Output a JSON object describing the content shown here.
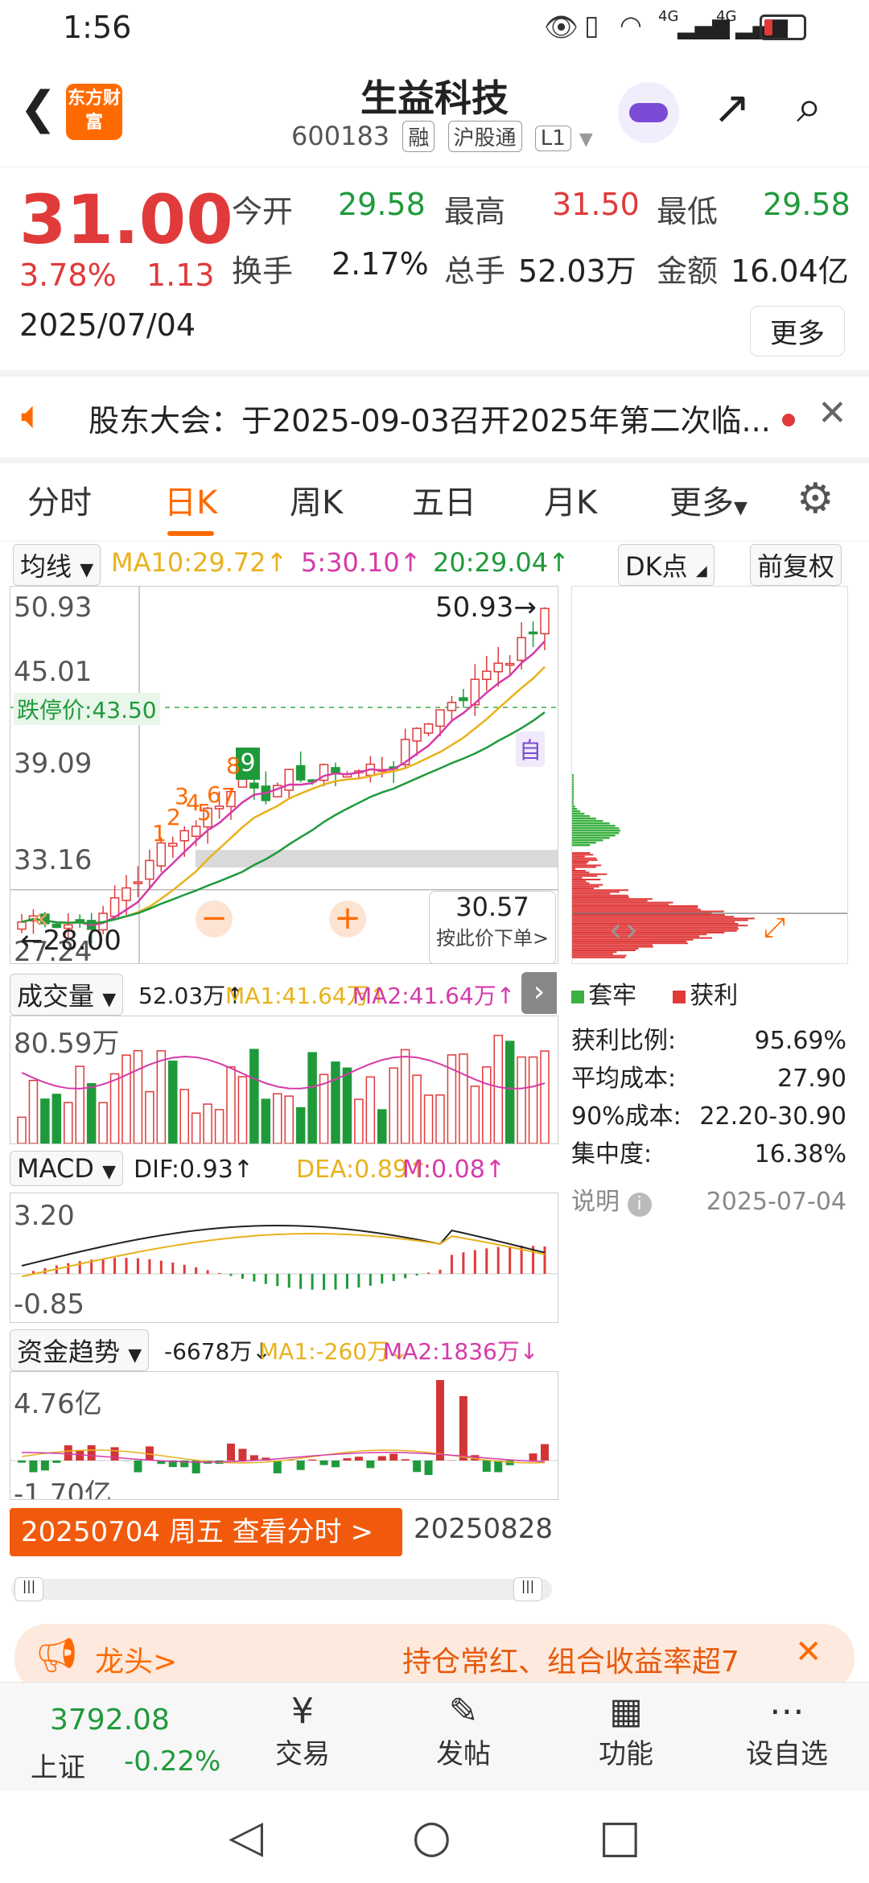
{
  "status_bar": {
    "time": "1:56",
    "net1": "4G",
    "net2": "4G"
  },
  "header": {
    "title": "生益科技",
    "code": "600183",
    "tags": [
      "融",
      "沪股通",
      "L1"
    ],
    "logo_text": "东方财富"
  },
  "quote": {
    "price": "31.00",
    "change_pct": "3.78%",
    "change": "1.13",
    "date": "2025/07/04",
    "open_label": "今开",
    "open": "29.58",
    "high_label": "最高",
    "high": "31.50",
    "low_label": "最低",
    "low": "29.58",
    "turnover_label": "换手",
    "turnover": "2.17%",
    "volume_label": "总手",
    "volume": "52.03万",
    "amount_label": "金额",
    "amount": "16.04亿",
    "more_label": "更多"
  },
  "notice": {
    "text": "股东大会：于2025-09-03召开2025年第二次临..."
  },
  "tabs": {
    "items": [
      "分时",
      "日K",
      "周K",
      "五日",
      "月K",
      "更多"
    ],
    "active": "日K"
  },
  "ma_bar": {
    "selector": "均线",
    "ma10": "MA10:29.72↑",
    "ma5": "5:30.10↑",
    "ma20": "20:29.04↑",
    "dk": "DK点",
    "adjust": "前复权"
  },
  "kline": {
    "price_labels": [
      "50.93",
      "45.01",
      "39.09",
      "33.16",
      "27.24"
    ],
    "limit_down": "跌停价:43.50",
    "max_annotation": "50.93",
    "min_annotation": "28.00",
    "self_tag": "自",
    "nine_label": "9",
    "number_labels": [
      "1",
      "2",
      "3",
      "4",
      "5",
      "6",
      "7",
      "8"
    ],
    "crosshair_price": "30.57",
    "crosshair_hint": "按此价下单",
    "watermark": "东方财富"
  },
  "chips": {
    "legend_trapped": "套牢",
    "legend_profit": "获利",
    "profit_ratio_label": "获利比例:",
    "profit_ratio": "95.69%",
    "avg_cost_label": "平均成本:",
    "avg_cost": "27.90",
    "cost90_label": "90%成本:",
    "cost90": "22.20-30.90",
    "concentration_label": "集中度:",
    "concentration": "16.38%",
    "note_label": "说明",
    "date": "2025-07-04",
    "colors": {
      "trapped": "#3cb043",
      "profit": "#e03a3a"
    }
  },
  "volume": {
    "selector": "成交量",
    "value": "52.03万↑",
    "ma1": "MA1:41.64万↑",
    "ma2": "MA2:41.64万↑",
    "top_label": "80.59万"
  },
  "macd": {
    "selector": "MACD",
    "dif": "DIF:0.93↑",
    "dea": "DEA:0.89↑",
    "m": "M:0.08↑",
    "top_label": "3.20",
    "bottom_label": "-0.85"
  },
  "fund": {
    "selector": "资金趋势",
    "value": "-6678万↓",
    "ma1": "MA1:-260万↓",
    "ma2": "MA2:1836万↓",
    "top_label": "4.76亿",
    "bottom_label": "-1.70亿"
  },
  "date_bar": {
    "left": "20250704 周五 查看分时 >",
    "right": "20250828"
  },
  "banner": {
    "left_text": "龙头>",
    "right_text": "持仓常红、组合收益率超7"
  },
  "bottom_nav": {
    "index_value": "3792.08",
    "index_name": "上证",
    "index_change": "-0.22%",
    "items": [
      "交易",
      "发帖",
      "功能",
      "设自选"
    ]
  },
  "colors": {
    "accent": "#ff6a00",
    "up": "#e03a3a",
    "down": "#1f9a3b",
    "ma5": "#d63aa8",
    "ma10": "#e8b21c",
    "ma20": "#1f9a3b"
  }
}
